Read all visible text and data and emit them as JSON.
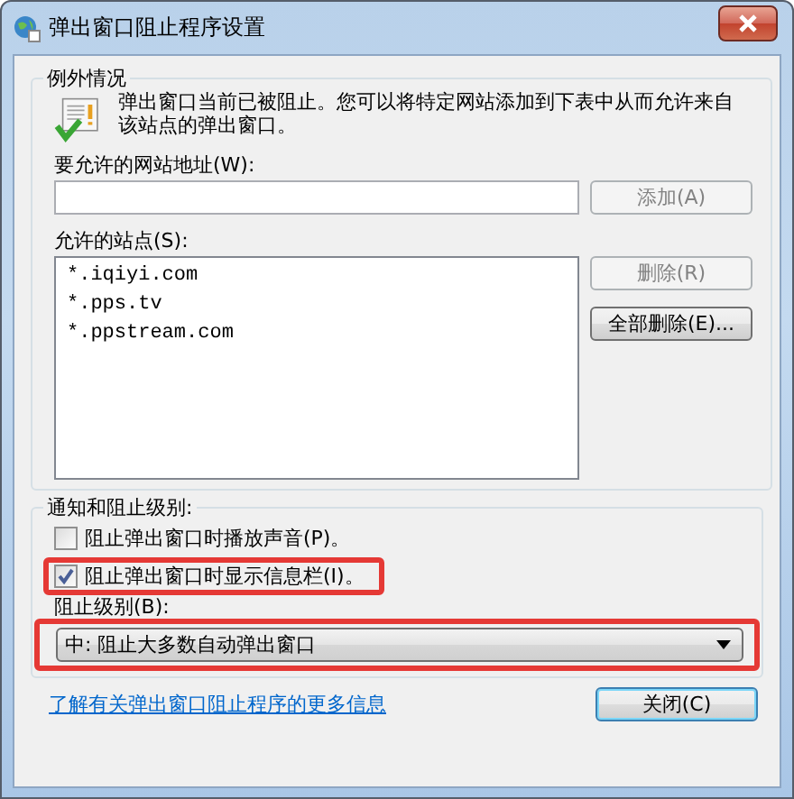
{
  "window": {
    "title": "弹出窗口阻止程序设置"
  },
  "exceptions": {
    "legend": "例外情况",
    "description": "弹出窗口当前已被阻止。您可以将特定网站添加到下表中从而允许来自该站点的弹出窗口。",
    "address_label": "要允许的网站地址(W):",
    "add_button": {
      "label": "添加(A)",
      "disabled": true
    },
    "sites_label": "允许的站点(S):",
    "sites": [
      "*.iqiyi.com",
      "*.pps.tv",
      "*.ppstream.com"
    ],
    "remove_button": {
      "label": "删除(R)",
      "disabled": true
    },
    "remove_all_button": {
      "label": "全部删除(E)...",
      "disabled": false
    }
  },
  "notifications": {
    "legend": "通知和阻止级别:",
    "options": [
      {
        "label": "阻止弹出窗口时播放声音(P)。",
        "checked": false,
        "highlighted": false
      },
      {
        "label": "阻止弹出窗口时显示信息栏(I)。",
        "checked": true,
        "highlighted": true
      }
    ],
    "level_label": "阻止级别(B):",
    "level": {
      "value": "中: 阻止大多数自动弹出窗口",
      "highlighted": true
    }
  },
  "footer": {
    "link": "了解有关弹出窗口阻止程序的更多信息",
    "close_button": "关闭(C)"
  }
}
